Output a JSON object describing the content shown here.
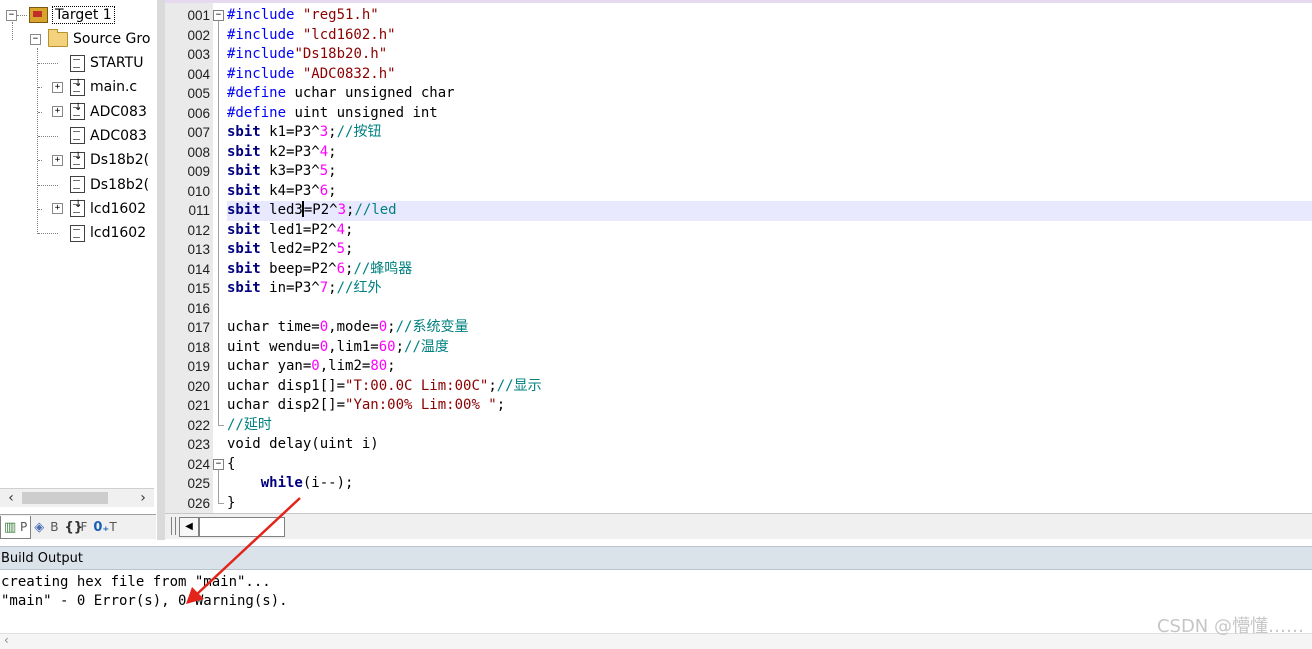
{
  "project": {
    "target": "Target 1",
    "group": "Source Gro",
    "files": [
      {
        "name": "STARTU",
        "expandable": false
      },
      {
        "name": "main.c",
        "expandable": true
      },
      {
        "name": "ADC083",
        "expandable": true
      },
      {
        "name": "ADC083",
        "expandable": false
      },
      {
        "name": "Ds18b2(",
        "expandable": true
      },
      {
        "name": "Ds18b2(",
        "expandable": false
      },
      {
        "name": "lcd1602",
        "expandable": true
      },
      {
        "name": "lcd1602",
        "expandable": false
      }
    ],
    "tabs": [
      {
        "icon": "project-icon",
        "label": "P",
        "active": true
      },
      {
        "icon": "books-icon",
        "label": "B",
        "active": false
      },
      {
        "icon": "functions-icon",
        "label": "F",
        "active": false
      },
      {
        "icon": "templates-icon",
        "label": "T",
        "active": false
      }
    ]
  },
  "editor": {
    "current_line": "011",
    "lines": [
      {
        "n": "001",
        "tokens": [
          {
            "t": "#include ",
            "c": "pp"
          },
          {
            "t": "\"reg51.h\"",
            "c": "str"
          }
        ]
      },
      {
        "n": "002",
        "tokens": [
          {
            "t": "#include ",
            "c": "pp"
          },
          {
            "t": "\"lcd1602.h\"",
            "c": "str"
          }
        ]
      },
      {
        "n": "003",
        "tokens": [
          {
            "t": "#include",
            "c": "pp"
          },
          {
            "t": "\"Ds18b20.h\"",
            "c": "str"
          }
        ]
      },
      {
        "n": "004",
        "tokens": [
          {
            "t": "#include ",
            "c": "pp"
          },
          {
            "t": "\"ADC0832.h\"",
            "c": "str"
          }
        ]
      },
      {
        "n": "005",
        "tokens": [
          {
            "t": "#define ",
            "c": "pp"
          },
          {
            "t": "uchar unsigned char",
            "c": ""
          }
        ]
      },
      {
        "n": "006",
        "tokens": [
          {
            "t": "#define ",
            "c": "pp"
          },
          {
            "t": "uint unsigned int",
            "c": ""
          }
        ]
      },
      {
        "n": "007",
        "tokens": [
          {
            "t": "sbit",
            "c": "kwb"
          },
          {
            "t": " k1=P3^",
            "c": ""
          },
          {
            "t": "3",
            "c": "num"
          },
          {
            "t": ";",
            "c": ""
          },
          {
            "t": "//按钮",
            "c": "cmt"
          }
        ]
      },
      {
        "n": "008",
        "tokens": [
          {
            "t": "sbit",
            "c": "kwb"
          },
          {
            "t": " k2=P3^",
            "c": ""
          },
          {
            "t": "4",
            "c": "num"
          },
          {
            "t": ";",
            "c": ""
          }
        ]
      },
      {
        "n": "009",
        "tokens": [
          {
            "t": "sbit",
            "c": "kwb"
          },
          {
            "t": " k3=P3^",
            "c": ""
          },
          {
            "t": "5",
            "c": "num"
          },
          {
            "t": ";",
            "c": ""
          }
        ]
      },
      {
        "n": "010",
        "tokens": [
          {
            "t": "sbit",
            "c": "kwb"
          },
          {
            "t": " k4=P3^",
            "c": ""
          },
          {
            "t": "6",
            "c": "num"
          },
          {
            "t": ";",
            "c": ""
          }
        ]
      },
      {
        "n": "011",
        "tokens": [
          {
            "t": "sbit",
            "c": "kwb"
          },
          {
            "t": " led3",
            "c": ""
          },
          {
            "t": "|",
            "c": "caret"
          },
          {
            "t": "=P2^",
            "c": ""
          },
          {
            "t": "3",
            "c": "num"
          },
          {
            "t": ";",
            "c": ""
          },
          {
            "t": "//led",
            "c": "cmt"
          }
        ]
      },
      {
        "n": "012",
        "tokens": [
          {
            "t": "sbit",
            "c": "kwb"
          },
          {
            "t": " led1=P2^",
            "c": ""
          },
          {
            "t": "4",
            "c": "num"
          },
          {
            "t": ";",
            "c": ""
          }
        ]
      },
      {
        "n": "013",
        "tokens": [
          {
            "t": "sbit",
            "c": "kwb"
          },
          {
            "t": " led2=P2^",
            "c": ""
          },
          {
            "t": "5",
            "c": "num"
          },
          {
            "t": ";",
            "c": ""
          }
        ]
      },
      {
        "n": "014",
        "tokens": [
          {
            "t": "sbit",
            "c": "kwb"
          },
          {
            "t": " beep=P2^",
            "c": ""
          },
          {
            "t": "6",
            "c": "num"
          },
          {
            "t": ";",
            "c": ""
          },
          {
            "t": "//蜂鸣器",
            "c": "cmt"
          }
        ]
      },
      {
        "n": "015",
        "tokens": [
          {
            "t": "sbit",
            "c": "kwb"
          },
          {
            "t": " in=P3^",
            "c": ""
          },
          {
            "t": "7",
            "c": "num"
          },
          {
            "t": ";",
            "c": ""
          },
          {
            "t": "//红外",
            "c": "cmt"
          }
        ]
      },
      {
        "n": "016",
        "tokens": []
      },
      {
        "n": "017",
        "tokens": [
          {
            "t": "uchar time=",
            "c": ""
          },
          {
            "t": "0",
            "c": "num"
          },
          {
            "t": ",mode=",
            "c": ""
          },
          {
            "t": "0",
            "c": "num"
          },
          {
            "t": ";",
            "c": ""
          },
          {
            "t": "//系统变量",
            "c": "cmt"
          }
        ]
      },
      {
        "n": "018",
        "tokens": [
          {
            "t": "uint wendu=",
            "c": ""
          },
          {
            "t": "0",
            "c": "num"
          },
          {
            "t": ",lim1=",
            "c": ""
          },
          {
            "t": "60",
            "c": "num"
          },
          {
            "t": ";",
            "c": ""
          },
          {
            "t": "//温度",
            "c": "cmt"
          }
        ]
      },
      {
        "n": "019",
        "tokens": [
          {
            "t": "uchar yan=",
            "c": ""
          },
          {
            "t": "0",
            "c": "num"
          },
          {
            "t": ",lim2=",
            "c": ""
          },
          {
            "t": "80",
            "c": "num"
          },
          {
            "t": ";",
            "c": ""
          }
        ]
      },
      {
        "n": "020",
        "tokens": [
          {
            "t": "uchar disp1[]=",
            "c": ""
          },
          {
            "t": "\"T:00.0C Lim:00C\"",
            "c": "str"
          },
          {
            "t": ";",
            "c": ""
          },
          {
            "t": "//显示",
            "c": "cmt"
          }
        ]
      },
      {
        "n": "021",
        "tokens": [
          {
            "t": "uchar disp2[]=",
            "c": ""
          },
          {
            "t": "\"Yan:00% Lim:00% \"",
            "c": "str"
          },
          {
            "t": ";",
            "c": ""
          }
        ]
      },
      {
        "n": "022",
        "tokens": [
          {
            "t": "//延时",
            "c": "cmt"
          }
        ]
      },
      {
        "n": "023",
        "tokens": [
          {
            "t": "void delay(uint i)",
            "c": ""
          }
        ]
      },
      {
        "n": "024",
        "tokens": [
          {
            "t": "{",
            "c": ""
          }
        ]
      },
      {
        "n": "025",
        "tokens": [
          {
            "t": "    ",
            "c": ""
          },
          {
            "t": "while",
            "c": "kwb"
          },
          {
            "t": "(i--);",
            "c": ""
          }
        ]
      },
      {
        "n": "026",
        "tokens": [
          {
            "t": "}",
            "c": ""
          }
        ]
      }
    ],
    "folds": {
      "open_box": [
        "001",
        "024"
      ],
      "end_mark": [
        "022",
        "026"
      ]
    }
  },
  "build_output": {
    "title": "Build Output",
    "lines": [
      "creating hex file from \"main\"...",
      "\"main\" - 0 Error(s), 0 Warning(s)."
    ]
  },
  "watermark": "CSDN @懵懂……",
  "colors": {
    "annotation_arrow": "#e3241b",
    "current_line_bg": "#e8e8ff",
    "comment": "#008080",
    "string": "#8b0000",
    "number": "#ff00ff"
  }
}
